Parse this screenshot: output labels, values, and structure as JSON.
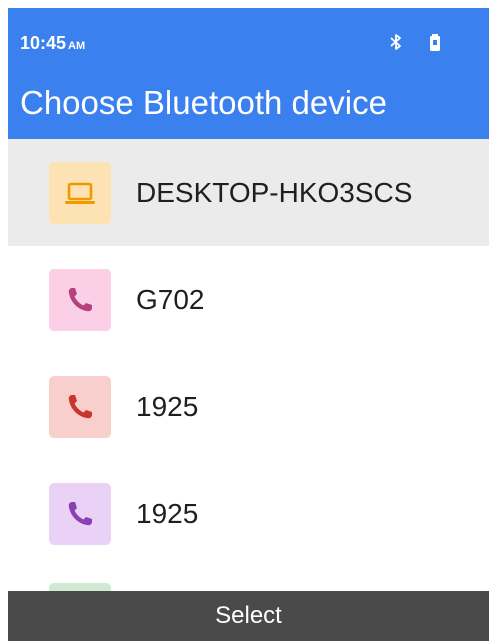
{
  "status_bar": {
    "time": "10:45",
    "ampm": "AM",
    "icons": [
      "bluetooth-icon",
      "battery-icon"
    ]
  },
  "header": {
    "title": "Choose Bluetooth device"
  },
  "devices": [
    {
      "name": "DESKTOP-HKO3SCS",
      "icon": "laptop-icon",
      "tile_color": "#fde3b3",
      "icon_color": "#f09a00",
      "selected": true
    },
    {
      "name": "G702",
      "icon": "phone-icon",
      "tile_color": "#fbcfe6",
      "icon_color": "#b5417f",
      "selected": false
    },
    {
      "name": "1925",
      "icon": "phone-icon",
      "tile_color": "#f9cfcd",
      "icon_color": "#c6382c",
      "selected": false
    },
    {
      "name": "1925",
      "icon": "phone-icon",
      "tile_color": "#ead2f7",
      "icon_color": "#8a3fb3",
      "selected": false
    }
  ],
  "partial_item": {
    "tile_color": "#cfead0"
  },
  "footer": {
    "select_label": "Select"
  },
  "colors": {
    "header_bg": "#3a80ee",
    "selected_bg": "#ebebeb",
    "footer_bg": "#4a4a4a"
  }
}
